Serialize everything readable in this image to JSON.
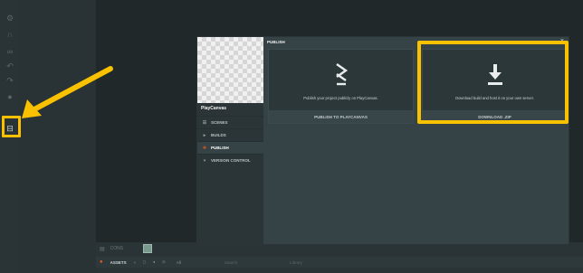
{
  "colors": {
    "accent": "#f25c19",
    "highlight": "#f9c100",
    "dialog_bg": "#364346",
    "editor_bg": "#20282a"
  },
  "toolbar": {
    "icons": [
      "gear-icon",
      "magnet-icon",
      "link-icon",
      "undo-icon",
      "redo-icon",
      "bulb-icon",
      "publish-icon"
    ]
  },
  "bottom": {
    "console_label": "CONS",
    "assets_label": "ASSETS",
    "filter_value": "All",
    "search_placeholder": "Search",
    "library_label": "Library"
  },
  "dialog": {
    "title": "PUBLISH",
    "close_glyph": "×",
    "project_name": "PlayCanvas",
    "menu": [
      {
        "label": "SCENES",
        "icon": "list-icon",
        "active": false
      },
      {
        "label": "BUILDS",
        "icon": "caret-icon",
        "active": false
      },
      {
        "label": "PUBLISH",
        "icon": "publish-icon",
        "active": true
      },
      {
        "label": "VERSION CONTROL",
        "icon": "branch-icon",
        "active": false
      }
    ],
    "cards": {
      "playcanvas": {
        "icon": "playcanvas-logo-icon",
        "description": "Publish your project publicly on PlayCanvas.",
        "button": "PUBLISH TO PLAYCANVAS"
      },
      "zip": {
        "icon": "download-icon",
        "description": "Download build and host it on your own server.",
        "button": "DOWNLOAD .ZIP"
      }
    }
  }
}
